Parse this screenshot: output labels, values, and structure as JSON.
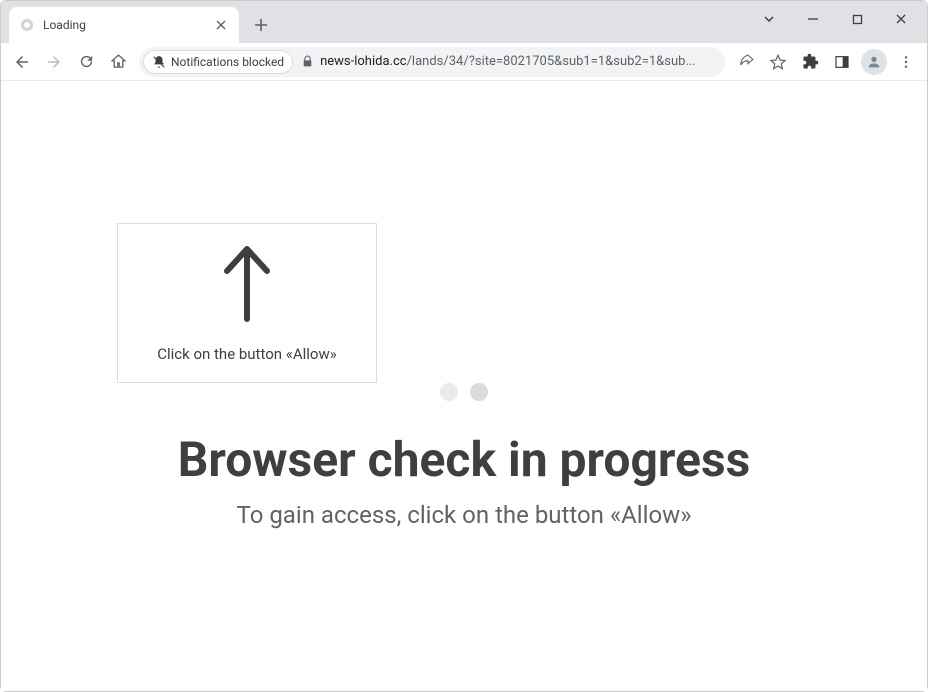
{
  "window": {
    "tab_title": "Loading"
  },
  "toolbar": {
    "notifications_blocked_label": "Notifications blocked",
    "url_domain": "news-lohida.cc",
    "url_path": "/lands/34/?site=8021705&sub1=1&sub2=1&sub..."
  },
  "page": {
    "callout_text": "Click on the button «Allow»",
    "headline": "Browser check in progress",
    "subhead": "To gain access, click on the button «Allow»"
  }
}
